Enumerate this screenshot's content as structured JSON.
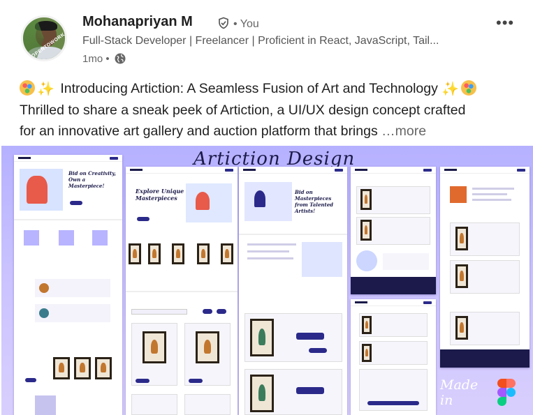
{
  "author": {
    "name": "Mohanapriyan M",
    "you_label": "• You",
    "headline": "Full-Stack Developer | Freelancer | Proficient in React, JavaScript, Tail...",
    "time": "1mo •",
    "avatar_badge": "#OPENTOWORK"
  },
  "post": {
    "line1": "Introducing Artiction: A Seamless Fusion of Art and Technology",
    "line2": "Thrilled to share a sneak peek of Artiction, a UI/UX design concept crafted",
    "line3": "for an innovative art gallery and auction platform that brings",
    "more_label": "…more"
  },
  "image": {
    "title": "Artiction Design",
    "made_in": "Made in"
  },
  "icons": {
    "verified": "shield-check-icon",
    "visibility": "globe-icon",
    "menu": "more-horizontal-icon"
  },
  "colors": {
    "accent": "#2b2a8a",
    "image_bg_top": "#b6b1ff",
    "image_bg_bottom": "#d9cffd"
  }
}
